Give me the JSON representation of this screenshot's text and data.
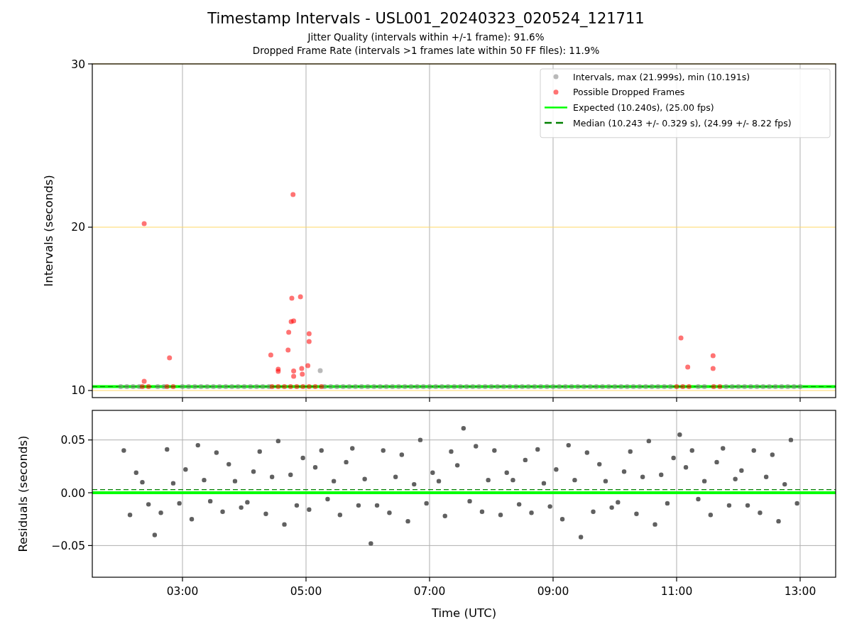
{
  "figure": {
    "title": "Timestamp Intervals - USL001_20240323_020524_121711",
    "subtitles": [
      "Jitter Quality (intervals within +/-1 frame): 91.6%",
      "Dropped Frame Rate (intervals >1 frames late within 50 FF files): 11.9%"
    ]
  },
  "panels": [
    {
      "chart_data": {
        "type": "scatter",
        "ylabel": "Intervals (seconds)",
        "xlim": [
          1.54,
          13.575
        ],
        "ylim": [
          9.565,
          30
        ],
        "yticks": [
          10,
          20,
          30
        ],
        "grid": "both",
        "legend": true,
        "series": [
          {
            "name": "Intervals, max (21.999s), min (10.191s)",
            "color": "#808080",
            "x": [
              2.0,
              2.1,
              2.2,
              2.3,
              2.6,
              2.7,
              3.0,
              3.1,
              3.2,
              3.3,
              3.4,
              3.5,
              3.6,
              3.7,
              3.8,
              3.9,
              4.0,
              4.1,
              4.2,
              4.3,
              4.4,
              5.3,
              5.4,
              5.5,
              5.6,
              5.7,
              5.8,
              5.9,
              6.0,
              6.1,
              6.2,
              6.3,
              6.4,
              6.5,
              6.6,
              6.7,
              6.8,
              6.9,
              7.0,
              7.1,
              7.2,
              7.3,
              7.4,
              7.5,
              7.6,
              7.7,
              7.8,
              7.9,
              8.0,
              8.1,
              8.2,
              8.3,
              8.4,
              8.5,
              8.6,
              8.7,
              8.8,
              8.9,
              9.0,
              9.1,
              9.2,
              9.3,
              9.4,
              9.5,
              9.6,
              9.7,
              9.8,
              9.9,
              10.0,
              10.1,
              10.2,
              10.3,
              10.4,
              10.5,
              10.6,
              10.7,
              10.8,
              10.9,
              11.35,
              11.45,
              11.8,
              11.9,
              12.0,
              12.1,
              12.2,
              12.3,
              12.4,
              12.5,
              12.6,
              12.7,
              12.8,
              12.9,
              13.0,
              5.23
            ],
            "values": [
              10.24,
              10.24,
              10.24,
              10.24,
              10.24,
              10.24,
              10.24,
              10.24,
              10.24,
              10.24,
              10.24,
              10.24,
              10.24,
              10.24,
              10.24,
              10.24,
              10.24,
              10.24,
              10.24,
              10.24,
              10.24,
              10.24,
              10.24,
              10.24,
              10.24,
              10.24,
              10.24,
              10.24,
              10.24,
              10.24,
              10.24,
              10.24,
              10.24,
              10.24,
              10.24,
              10.24,
              10.24,
              10.24,
              10.24,
              10.24,
              10.24,
              10.24,
              10.24,
              10.24,
              10.24,
              10.24,
              10.24,
              10.24,
              10.24,
              10.24,
              10.24,
              10.24,
              10.24,
              10.24,
              10.24,
              10.24,
              10.24,
              10.24,
              10.24,
              10.24,
              10.24,
              10.24,
              10.24,
              10.24,
              10.24,
              10.24,
              10.24,
              10.24,
              10.24,
              10.24,
              10.24,
              10.24,
              10.24,
              10.24,
              10.24,
              10.24,
              10.24,
              10.24,
              10.24,
              10.24,
              10.24,
              10.24,
              10.24,
              10.24,
              10.24,
              10.24,
              10.24,
              10.24,
              10.24,
              10.24,
              10.24,
              10.24,
              10.24,
              11.22
            ]
          },
          {
            "name": "Possible Dropped Frames",
            "color": "#ff0000",
            "x": [
              2.38,
              2.38,
              2.79,
              4.43,
              4.55,
              4.55,
              4.71,
              4.72,
              4.76,
              4.77,
              4.8,
              4.79,
              4.8,
              4.8,
              4.91,
              4.93,
              4.94,
              5.03,
              5.05,
              5.05,
              11.07,
              11.18,
              11.59,
              11.59,
              2.35,
              2.45,
              2.75,
              2.85,
              4.45,
              4.55,
              4.65,
              4.75,
              4.85,
              4.95,
              5.05,
              5.15,
              5.25,
              11.0,
              11.1,
              11.2,
              11.6,
              11.7
            ],
            "values": [
              20.22,
              10.57,
              12.0,
              12.17,
              11.3,
              11.17,
              12.48,
              13.57,
              14.22,
              15.65,
              14.26,
              22.0,
              11.2,
              10.87,
              15.74,
              11.35,
              11.0,
              11.52,
              13.48,
              13.0,
              13.22,
              11.43,
              12.13,
              11.35,
              10.24,
              10.24,
              10.24,
              10.24,
              10.24,
              10.24,
              10.24,
              10.24,
              10.24,
              10.24,
              10.24,
              10.24,
              10.24,
              10.24,
              10.24,
              10.24,
              10.24,
              10.24
            ]
          }
        ],
        "ref_lines": [
          {
            "axis": "y",
            "value": 10.24,
            "color": "#00ff00",
            "label": "Expected (10.240s), (25.00 fps)"
          },
          {
            "axis": "y",
            "value": 10.24,
            "color": "#008000",
            "label": "Median (10.243 +/- 0.329 s), (24.99 +/- 8.22 fps)"
          }
        ]
      }
    },
    {
      "chart_data": {
        "type": "scatter",
        "xlabel": "Time (UTC)",
        "ylabel": "Residuals (seconds)",
        "xlim": [
          1.54,
          13.575
        ],
        "ylim": [
          -0.08,
          0.078
        ],
        "grid": "both",
        "xticks": [
          {
            "value": 3,
            "label": "03:00"
          },
          {
            "value": 5,
            "label": "05:00"
          },
          {
            "value": 7,
            "label": "07:00"
          },
          {
            "value": 9,
            "label": "09:00"
          },
          {
            "value": 11,
            "label": "11:00"
          },
          {
            "value": 13,
            "label": "13:00"
          }
        ],
        "yticks": [
          {
            "value": 0.05,
            "label": "0.05"
          },
          {
            "value": 0,
            "label": "0.00"
          },
          {
            "value": -0.05,
            "label": "−0.05"
          }
        ],
        "series": [
          {
            "color": "#606060",
            "x": [
              2.05,
              2.15,
              2.25,
              2.35,
              2.45,
              2.55,
              2.65,
              2.75,
              2.85,
              2.95,
              3.05,
              3.15,
              3.25,
              3.35,
              3.45,
              3.55,
              3.65,
              3.75,
              3.85,
              3.95,
              4.05,
              4.15,
              4.25,
              4.35,
              4.45,
              4.55,
              4.65,
              4.75,
              4.85,
              4.95,
              5.05,
              5.15,
              5.25,
              5.35,
              5.45,
              5.55,
              5.65,
              5.75,
              5.85,
              5.95,
              6.05,
              6.15,
              6.25,
              6.35,
              6.45,
              6.55,
              6.65,
              6.75,
              6.85,
              6.95,
              7.05,
              7.15,
              7.25,
              7.35,
              7.45,
              7.55,
              7.65,
              7.75,
              7.85,
              7.95,
              8.05,
              8.15,
              8.25,
              8.35,
              8.45,
              8.55,
              8.65,
              8.75,
              8.85,
              8.95,
              9.05,
              9.15,
              9.25,
              9.35,
              9.45,
              9.55,
              9.65,
              9.75,
              9.85,
              9.95,
              10.05,
              10.15,
              10.25,
              10.35,
              10.45,
              10.55,
              10.65,
              10.75,
              10.85,
              10.95,
              11.05,
              11.15,
              11.25,
              11.35,
              11.45,
              11.55,
              11.65,
              11.75,
              11.85,
              11.95,
              12.05,
              12.15,
              12.25,
              12.35,
              12.45,
              12.55,
              12.65,
              12.75,
              12.85,
              12.95
            ],
            "values": [
              0.04,
              -0.021,
              0.019,
              0.01,
              -0.011,
              -0.04,
              -0.019,
              0.041,
              0.009,
              -0.01,
              0.022,
              -0.025,
              0.045,
              0.012,
              -0.008,
              0.038,
              -0.018,
              0.027,
              0.011,
              -0.014,
              -0.009,
              0.02,
              0.039,
              -0.02,
              0.015,
              0.049,
              -0.03,
              0.017,
              -0.012,
              0.033,
              -0.016,
              0.024,
              0.04,
              -0.006,
              0.011,
              -0.021,
              0.029,
              0.042,
              -0.012,
              0.013,
              -0.048,
              -0.012,
              0.04,
              -0.019,
              0.015,
              0.036,
              -0.027,
              0.008,
              0.05,
              -0.01,
              0.019,
              0.011,
              -0.022,
              0.039,
              0.026,
              0.061,
              -0.008,
              0.044,
              -0.018,
              0.012,
              0.04,
              -0.021,
              0.019,
              0.012,
              -0.011,
              0.031,
              -0.019,
              0.041,
              0.009,
              -0.013,
              0.022,
              -0.025,
              0.045,
              0.012,
              -0.042,
              0.038,
              -0.018,
              0.027,
              0.011,
              -0.014,
              -0.009,
              0.02,
              0.039,
              -0.02,
              0.015,
              0.049,
              -0.03,
              0.017,
              -0.01,
              0.033,
              0.055,
              0.024,
              0.04,
              -0.006,
              0.011,
              -0.021,
              0.029,
              0.042,
              -0.012,
              0.013,
              0.021,
              -0.012,
              0.04,
              -0.019,
              0.015,
              0.036,
              -0.027,
              0.008,
              0.05,
              -0.01
            ]
          }
        ],
        "ref_lines": [
          {
            "axis": "y",
            "value": 0,
            "color": "#00ff00"
          },
          {
            "axis": "y",
            "value": 0.003,
            "color": "#008000"
          }
        ]
      }
    }
  ]
}
